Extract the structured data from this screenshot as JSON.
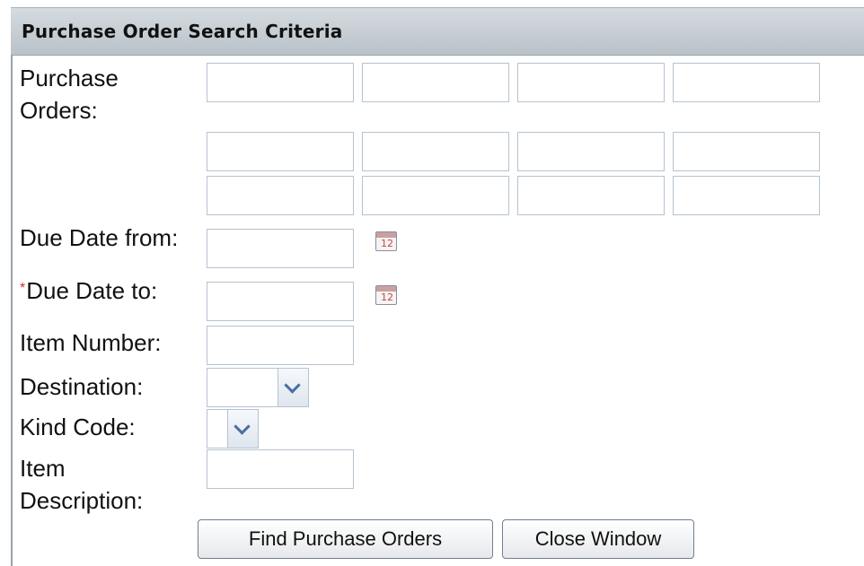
{
  "header": {
    "title": "Purchase Order Search Criteria"
  },
  "form": {
    "purchase_orders": {
      "label_line1": "Purchase",
      "label_line2": "Orders:",
      "values": [
        "",
        "",
        "",
        "",
        "",
        "",
        "",
        "",
        "",
        "",
        "",
        ""
      ]
    },
    "due_date_from": {
      "label": "Due Date from:",
      "value": "",
      "calendar_icon": "calendar-icon"
    },
    "due_date_to": {
      "required_marker": "*",
      "label": "Due Date to:",
      "value": "",
      "calendar_icon": "calendar-icon"
    },
    "item_number": {
      "label": "Item Number:",
      "value": ""
    },
    "destination": {
      "label": "Destination:",
      "selected": ""
    },
    "kind_code": {
      "label": "Kind Code:",
      "selected": ""
    },
    "item_description": {
      "label_line1": "Item",
      "label_line2": "Description:",
      "value": ""
    }
  },
  "buttons": {
    "find": "Find Purchase Orders",
    "close": "Close Window"
  },
  "colors": {
    "header_bg": "#c4ccd2",
    "field_border": "#b6c3cf",
    "required": "#d23030",
    "chevron": "#4a6ea0"
  }
}
